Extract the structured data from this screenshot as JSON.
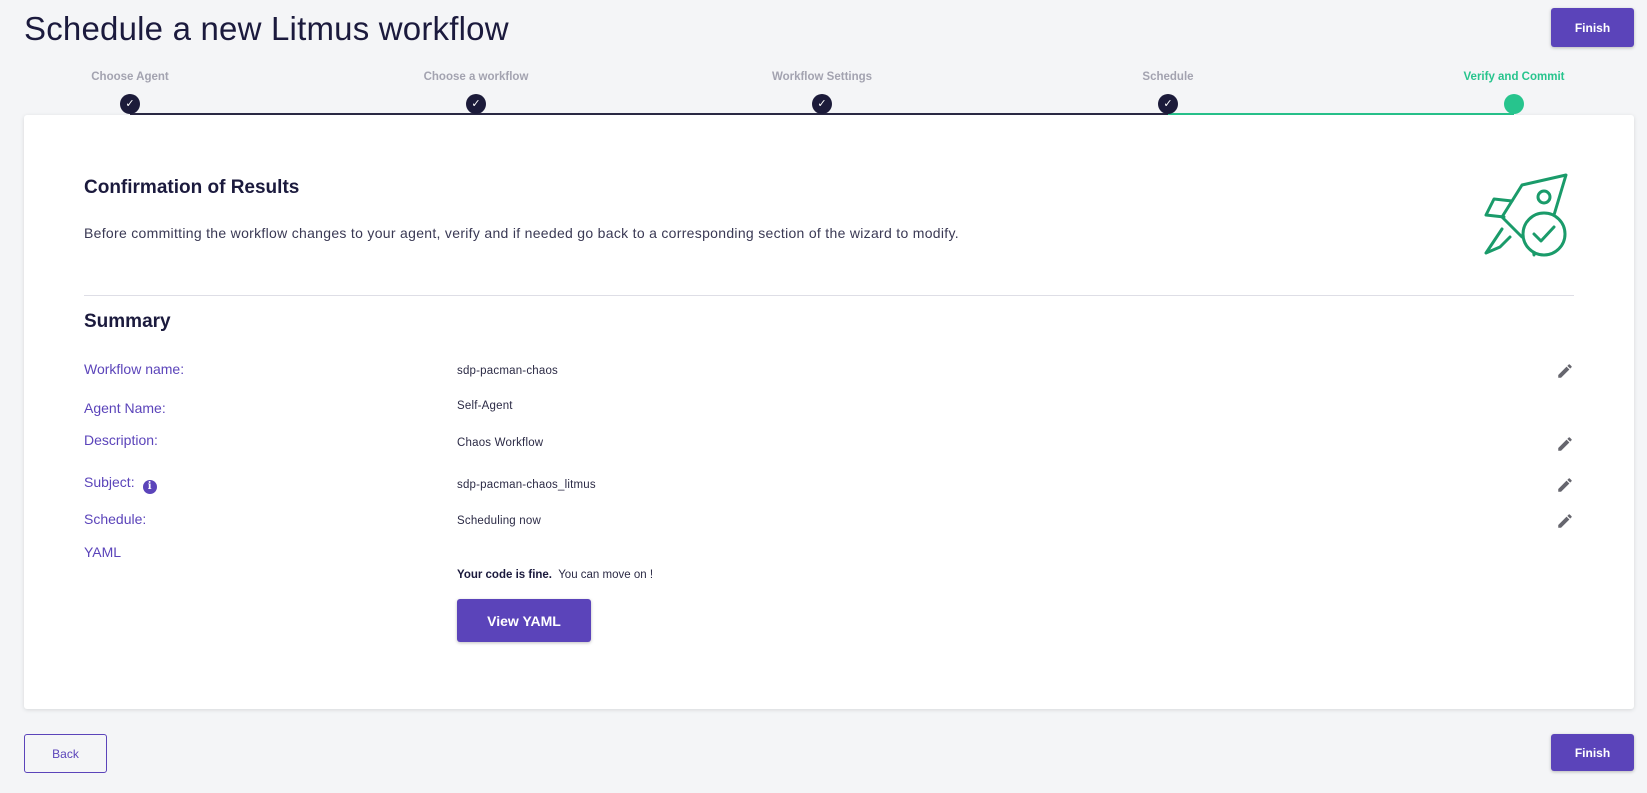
{
  "header": {
    "title": "Schedule a new Litmus workflow",
    "finish_label": "Finish"
  },
  "stepper": {
    "steps": [
      {
        "label": "Choose Agent",
        "state": "done"
      },
      {
        "label": "Choose a workflow",
        "state": "done"
      },
      {
        "label": "Workflow Settings",
        "state": "done"
      },
      {
        "label": "Schedule",
        "state": "done"
      },
      {
        "label": "Verify and Commit",
        "state": "active"
      }
    ],
    "check_glyph": "✓",
    "colors": {
      "done": "#1c1b3a",
      "active": "#27c48d",
      "inactive_label": "#a3a3b0"
    }
  },
  "confirmation": {
    "title": "Confirmation of Results",
    "description": "Before committing the workflow changes to your agent, verify and if needed go back to a corresponding section of the wizard to modify.",
    "icon": "rocket-check-icon"
  },
  "summary": {
    "title": "Summary",
    "workflow_name_label": "Workflow name:",
    "workflow_name_value": "sdp-pacman-chaos",
    "agent_name_label": "Agent Name:",
    "agent_name_value": "Self-Agent",
    "description_label": "Description:",
    "description_value": "Chaos Workflow",
    "subject_label": "Subject:",
    "subject_value": "sdp-pacman-chaos_litmus",
    "schedule_label": "Schedule:",
    "schedule_value": "Scheduling now",
    "yaml_label": "YAML",
    "yaml_status_bold": "Your code is fine.",
    "yaml_status_rest": "You can move on !",
    "view_yaml_label": "View YAML"
  },
  "footer": {
    "back_label": "Back",
    "finish_label": "Finish"
  },
  "colors": {
    "accent": "#5b44ba",
    "success": "#27c48d",
    "background": "#f4f5f7"
  }
}
